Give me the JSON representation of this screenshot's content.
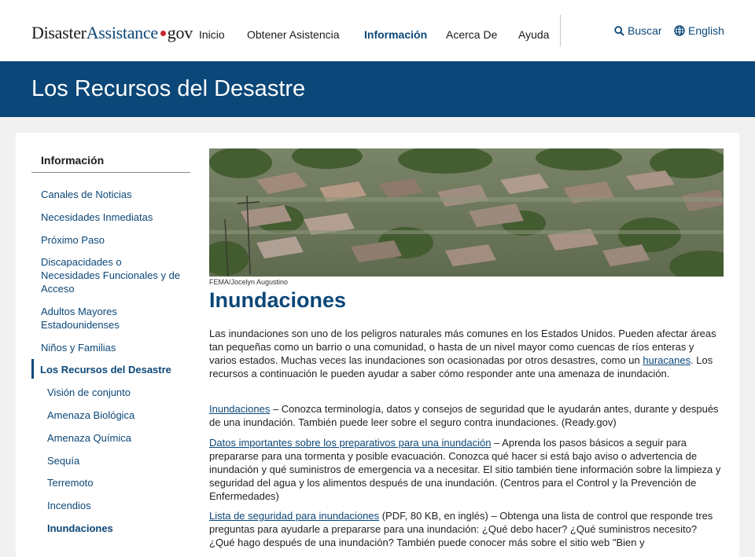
{
  "header": {
    "logo_part1": "Disaster",
    "logo_part2": "Assistance",
    "logo_part3": "gov",
    "nav": [
      "Inicio",
      "Obtener Asistencia",
      "Información",
      "Acerca De",
      "Ayuda"
    ],
    "active_nav": "Información",
    "search_label": "Buscar",
    "language_label": "English"
  },
  "banner": {
    "title": "Los Recursos del Desastre"
  },
  "sidebar": {
    "heading": "Información",
    "items": [
      "Canales de Noticias",
      "Necesidades Inmediatas",
      "Próximo Paso",
      "Discapacidades o Necesidades Funcionales y de Acceso",
      "Adultos Mayores Estadounidenses",
      "Niños y Familias",
      "Los Recursos del Desastre"
    ],
    "current": "Los Recursos del Desastre",
    "subitems": [
      "Visión de conjunto",
      "Amenaza Biológica",
      "Amenaza Química",
      "Sequía",
      "Terremoto",
      "Incendios",
      "Inundaciones"
    ],
    "sub_active": "Inundaciones"
  },
  "main": {
    "photo_credit": "FEMA/Jocelyn Augustino",
    "title": "Inundaciones",
    "intro_before_link": "Las inundaciones son uno de los peligros naturales más comunes en los Estados Unidos. Pueden afectar áreas tan pequeñas como un barrio o una comunidad, o hasta de un nivel mayor como cuencas de ríos enteras y varios estados. Muchas veces las inundaciones son ocasionadas por otros desastres, como un ",
    "intro_link": "huracanes",
    "intro_after_link": ". Los recursos a continuación le pueden ayudar a saber cómo responder ante una amenaza de inundación.",
    "resources": [
      {
        "link": "Inundaciones",
        "text": " – Conozca terminología, datos y consejos de seguridad que le ayudarán antes, durante y después de una inundación. También puede leer sobre el seguro contra inundaciones. (Ready.gov)"
      },
      {
        "link": "Datos importantes sobre los preparativos para una inundación",
        "text": " – Aprenda los pasos básicos a seguir para prepararse para una tormenta y posible evacuación. Conozca qué hacer si está bajo aviso o advertencia de inundación y qué suministros de emergencia va a necesitar. El sitio también tiene información sobre la limpieza y seguridad del agua y los alimentos después de una inundación. (Centros para el Control y la Prevención de Enfermedades)"
      },
      {
        "link": "Lista de seguridad para inundaciones",
        "text": " (PDF, 80 KB, en inglés) – Obtenga una lista de control que responde tres preguntas para ayudarle a prepararse para una inundación: ¿Qué debo hacer? ¿Qué suministros necesito? ¿Qué hago después de una inundación? También puede conocer más sobre el sitio web \"Bien y"
      }
    ]
  },
  "colors": {
    "brand_blue": "#0b4778",
    "logo_dot": "#c9262c",
    "page_bg": "#f1f1f1"
  }
}
